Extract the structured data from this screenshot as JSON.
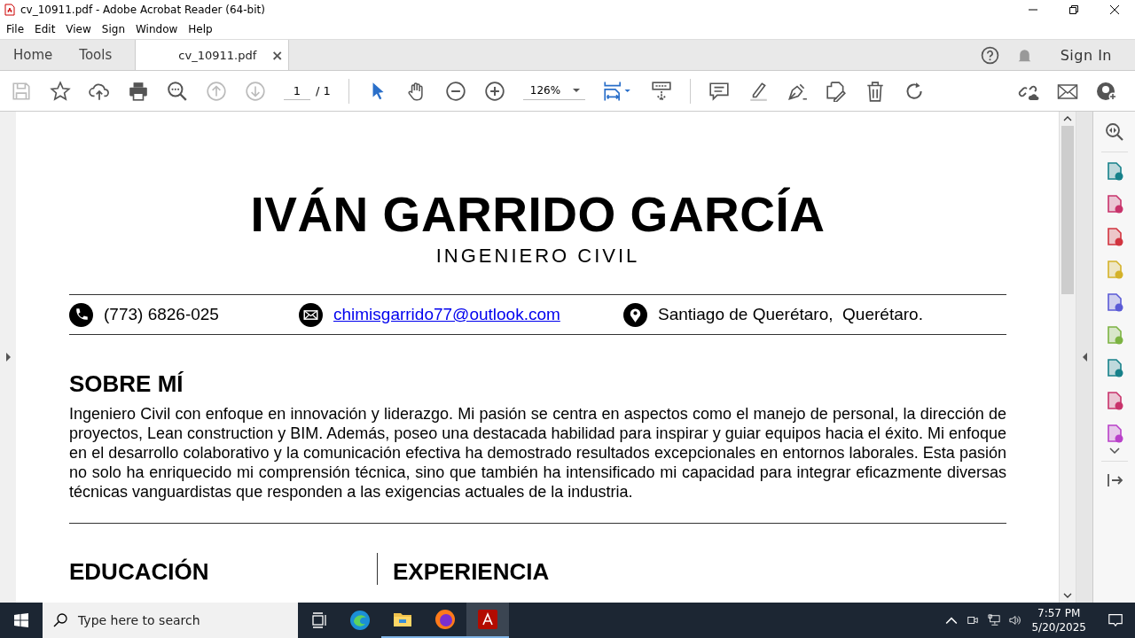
{
  "window": {
    "title": "cv_10911.pdf - Adobe Acrobat Reader (64-bit)"
  },
  "menu": [
    "File",
    "Edit",
    "View",
    "Sign",
    "Window",
    "Help"
  ],
  "tabs": [
    {
      "label": "Home",
      "selected": false
    },
    {
      "label": "Tools",
      "selected": false
    },
    {
      "label": "cv_10911.pdf",
      "selected": true,
      "close": "×"
    }
  ],
  "account": {
    "sign_in": "Sign In"
  },
  "toolbar": {
    "page": "1",
    "page_total": "/ 1",
    "zoom": "126%"
  },
  "document": {
    "name": "IVÁN GARRIDO GARCÍA",
    "profession": "INGENIERO CIVIL",
    "contacts": [
      {
        "kind": "phone",
        "text": "(773) 6826-025",
        "link": false
      },
      {
        "kind": "email",
        "text": "chimisgarrido77@outlook.com",
        "link": true
      },
      {
        "kind": "location",
        "text": "Santiago de Querétaro,  Querétaro.",
        "link": false
      }
    ],
    "about": {
      "heading": "SOBRE MÍ",
      "text": "Ingeniero Civil con enfoque en innovación y liderazgo. Mi pasión se centra en aspectos como el manejo de personal, la dirección de proyectos, Lean construction y BIM. Además, poseo una destacada habilidad para inspirar y guiar equipos hacia el éxito. Mi enfoque en el desarrollo colaborativo y la comunicación efectiva ha demostrado resultados excepcionales en entornos laborales. Esta pasión no solo ha enriquecido mi comprensión técnica, sino que también ha intensificado mi capacidad para integrar eficazmente diversas técnicas vanguardistas que responden a las exigencias actuales de la industria."
    },
    "columns": [
      "EDUCACIÓN",
      "EXPERIENCIA"
    ]
  },
  "taskbar": {
    "search_placeholder": "Type here to search",
    "time": "7:57 PM",
    "date": "5/20/2025"
  }
}
